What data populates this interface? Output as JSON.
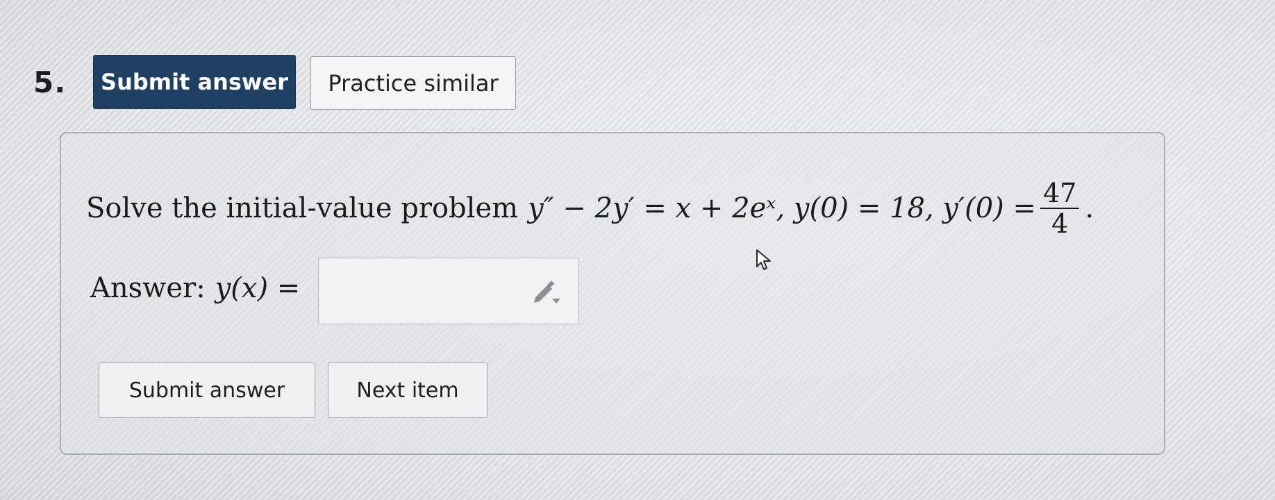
{
  "question": {
    "number": "5."
  },
  "top_toolbar": {
    "submit_label": "Submit answer",
    "practice_label": "Practice similar"
  },
  "problem": {
    "intro_text": "Solve the initial-value problem",
    "equation": "y″ − 2y′ = x + 2eˣ,  y(0) = 18,  y′(0) = ",
    "fraction_numerator": "47",
    "fraction_denominator": "4",
    "trailing": "."
  },
  "answer": {
    "label_text": "Answer:",
    "label_math": "y(x) =",
    "input_value": ""
  },
  "bottom_actions": {
    "submit_label": "Submit answer",
    "next_label": "Next item"
  },
  "icons": {
    "input_tool": "pencil-icon",
    "pointer": "cursor-icon"
  },
  "colors": {
    "primary_button": "#1f3f63",
    "primary_text": "#ffffff"
  }
}
